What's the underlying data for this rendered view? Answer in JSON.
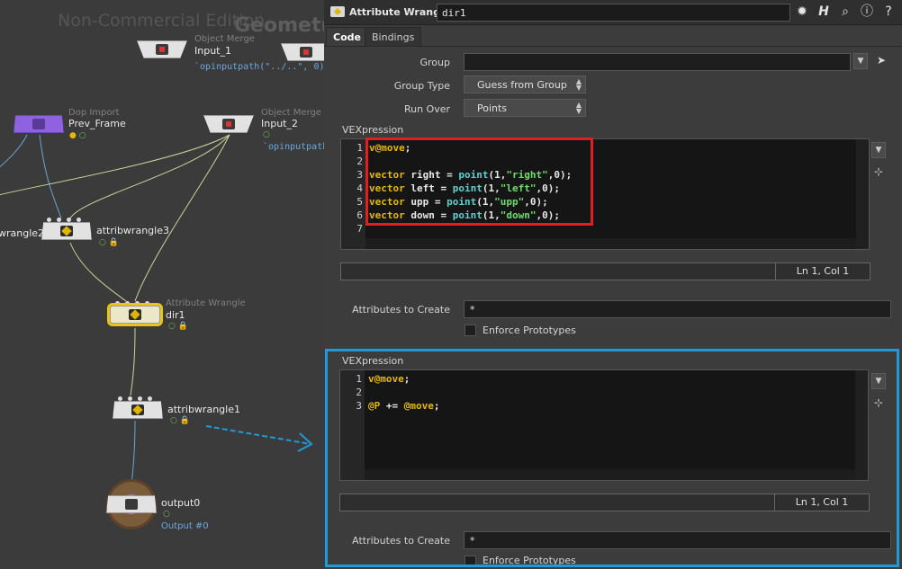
{
  "network": {
    "watermark": "Non-Commercial Edition",
    "context_title": "Geometry",
    "nodes": {
      "input1": {
        "type": "Object Merge",
        "name": "Input_1",
        "expr": "`opinputpath(\"../..\", 0)`"
      },
      "input2": {
        "type": "Object Merge",
        "name": "Input_2",
        "expr": "`opinputpath(\""
      },
      "prev": {
        "type": "Dop Import",
        "name": "Prev_Frame"
      },
      "wrangle2": {
        "name": "wrangle2"
      },
      "wrangle3": {
        "name": "attribwrangle3"
      },
      "dir1": {
        "type": "Attribute Wrangle",
        "name": "dir1"
      },
      "wrangle1": {
        "name": "attribwrangle1"
      },
      "output0": {
        "name": "output0",
        "sub": "Output #0"
      }
    }
  },
  "params": {
    "header": {
      "node_type": "Attribute Wrangle",
      "node_name": "dir1"
    },
    "tabs": [
      "Code",
      "Bindings"
    ],
    "group": {
      "label": "Group",
      "value": ""
    },
    "group_type": {
      "label": "Group Type",
      "value": "Guess from Group"
    },
    "run_over": {
      "label": "Run Over",
      "value": "Points"
    },
    "vex1": {
      "label": "VEXpression",
      "line_numbers": [
        "1",
        "2",
        "3",
        "4",
        "5",
        "6",
        "7"
      ],
      "status": "Ln 1, Col 1"
    },
    "attrs1": {
      "label": "Attributes to Create",
      "value": "*"
    },
    "enforce1": "Enforce Prototypes",
    "vex2": {
      "label": "VEXpression",
      "line_numbers": [
        "1",
        "2",
        "3"
      ],
      "status": "Ln 1, Col 1"
    },
    "attrs2": {
      "label": "Attributes to Create",
      "value": "*"
    },
    "enforce2": "Enforce Prototypes"
  },
  "code1": [
    [
      {
        "t": "v@move",
        "c": "kw"
      },
      {
        "t": ";",
        "c": "plain"
      }
    ],
    [],
    [
      {
        "t": "vector",
        "c": "kw"
      },
      {
        "t": " right = ",
        "c": "plain"
      },
      {
        "t": "point",
        "c": "fn"
      },
      {
        "t": "(1,",
        "c": "plain"
      },
      {
        "t": "\"right\"",
        "c": "str"
      },
      {
        "t": ",0);",
        "c": "plain"
      }
    ],
    [
      {
        "t": "vector",
        "c": "kw"
      },
      {
        "t": " left = ",
        "c": "plain"
      },
      {
        "t": "point",
        "c": "fn"
      },
      {
        "t": "(1,",
        "c": "plain"
      },
      {
        "t": "\"left\"",
        "c": "str"
      },
      {
        "t": ",0);",
        "c": "plain"
      }
    ],
    [
      {
        "t": "vector",
        "c": "kw"
      },
      {
        "t": " upp = ",
        "c": "plain"
      },
      {
        "t": "point",
        "c": "fn"
      },
      {
        "t": "(1,",
        "c": "plain"
      },
      {
        "t": "\"upp\"",
        "c": "str"
      },
      {
        "t": ",0);",
        "c": "plain"
      }
    ],
    [
      {
        "t": "vector",
        "c": "kw"
      },
      {
        "t": " down = ",
        "c": "plain"
      },
      {
        "t": "point",
        "c": "fn"
      },
      {
        "t": "(1,",
        "c": "plain"
      },
      {
        "t": "\"down\"",
        "c": "str"
      },
      {
        "t": ",0);",
        "c": "plain"
      }
    ],
    []
  ],
  "code2": [
    [
      {
        "t": "v@move",
        "c": "kw"
      },
      {
        "t": ";",
        "c": "plain"
      }
    ],
    [],
    [
      {
        "t": "@P",
        "c": "kw"
      },
      {
        "t": " += ",
        "c": "plain"
      },
      {
        "t": "@move",
        "c": "kw"
      },
      {
        "t": ";",
        "c": "plain"
      }
    ]
  ],
  "colors": {
    "highlight_red": "#e02020",
    "highlight_blue": "#1f9ad6",
    "selected_node": "#e8c51e"
  },
  "icons": [
    "gear-icon",
    "houdini-icon",
    "search-icon",
    "info-icon",
    "help-icon",
    "pin-icon"
  ]
}
